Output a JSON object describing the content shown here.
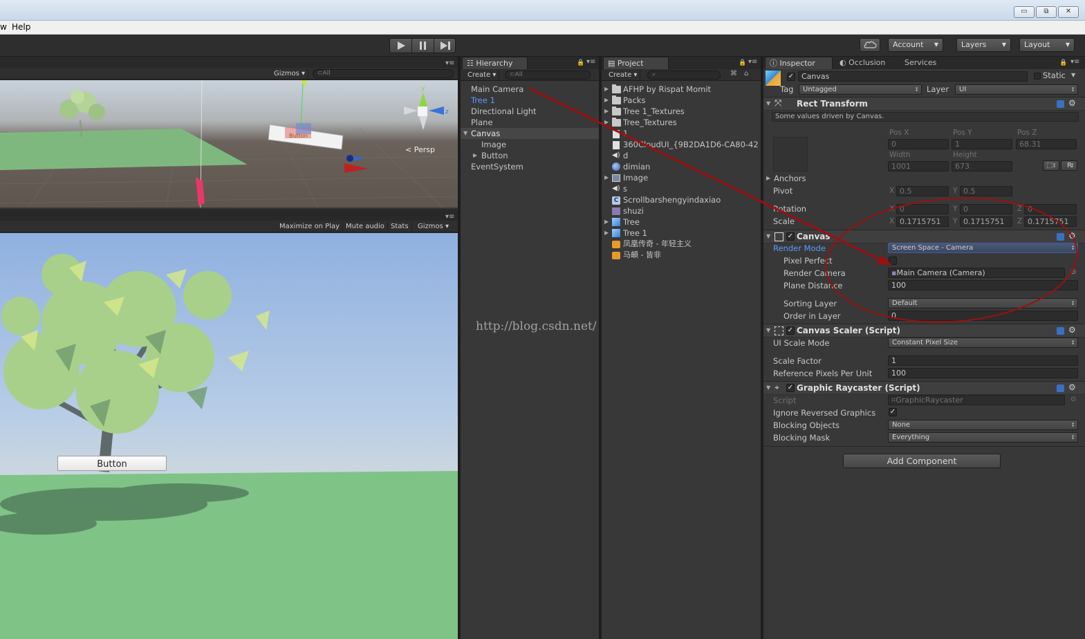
{
  "window": {
    "min": "▭",
    "max": "⧉",
    "close": "✕"
  },
  "menu": {
    "partial": "w",
    "help": "Help"
  },
  "toolbar": {
    "cloud_icon": "cloud-icon",
    "account": "Account",
    "layers": "Layers",
    "layout": "Layout"
  },
  "scene": {
    "gizmos": "Gizmos",
    "search_placeholder": "⊂All",
    "persp": "Persp",
    "axis_y": "y",
    "axis_z": "z",
    "object_label": "Button"
  },
  "game": {
    "maximize": "Maximize on Play",
    "mute": "Mute audio",
    "stats": "Stats",
    "gizmos": "Gizmos",
    "button_label": "Button"
  },
  "hierarchy": {
    "tab": "Hierarchy",
    "create": "Create",
    "search": "⊂All",
    "items": [
      "Main Camera",
      "Tree 1",
      "Directional Light",
      "Plane",
      "Canvas",
      "Image",
      "Button",
      "EventSystem"
    ]
  },
  "project": {
    "tab": "Project",
    "create": "Create",
    "items": [
      "AFHP by Rispat Momit",
      "Packs",
      "Tree 1_Textures",
      "Tree_Textures",
      "1",
      "360CloudUI_{9B2DA1D6-CA80-42",
      "d",
      "dimian",
      "Image",
      "s",
      "Scrollbarshengyindaxiao",
      "shuzi",
      "Tree",
      "Tree 1",
      "凤凰传奇 - 年轻主义",
      "马頔 - 皆非"
    ]
  },
  "watermark": "http://blog.csdn.net/",
  "inspector": {
    "tabs": [
      "Inspector",
      "Occlusion",
      "Services"
    ],
    "object_name": "Canvas",
    "static": "Static",
    "tag_label": "Tag",
    "tag_value": "Untagged",
    "layer_label": "Layer",
    "layer_value": "UI",
    "rect": {
      "title": "Rect Transform",
      "note": "Some values driven by Canvas.",
      "posx_label": "Pos X",
      "posy_label": "Pos Y",
      "posz_label": "Pos Z",
      "posx": "0",
      "posy": "1",
      "posz": "68.31",
      "width_label": "Width",
      "height_label": "Height",
      "width": "1001",
      "height": "673",
      "r_button": "R",
      "anchors": "Anchors",
      "pivot": "Pivot",
      "pivot_x": "0.5",
      "pivot_y": "0.5",
      "rotation": "Rotation",
      "rot_x": "0",
      "rot_y": "0",
      "rot_z": "0",
      "scale": "Scale",
      "scale_x": "0.1715751",
      "scale_y": "0.1715751",
      "scale_z": "0.1715751",
      "x": "X",
      "y": "Y",
      "z": "Z"
    },
    "canvas": {
      "title": "Canvas",
      "render_mode_label": "Render Mode",
      "render_mode": "Screen Space - Camera",
      "pixel_perfect": "Pixel Perfect",
      "render_camera_label": "Render Camera",
      "render_camera": "Main Camera (Camera)",
      "plane_distance_label": "Plane Distance",
      "plane_distance": "100",
      "sorting_layer_label": "Sorting Layer",
      "sorting_layer": "Default",
      "order_label": "Order in Layer",
      "order": "0"
    },
    "scaler": {
      "title": "Canvas Scaler (Script)",
      "mode_label": "UI Scale Mode",
      "mode": "Constant Pixel Size",
      "factor_label": "Scale Factor",
      "factor": "1",
      "ppu_label": "Reference Pixels Per Unit",
      "ppu": "100"
    },
    "raycaster": {
      "title": "Graphic Raycaster (Script)",
      "script_label": "Script",
      "script": "GraphicRaycaster",
      "ignore_label": "Ignore Reversed Graphics",
      "blocking_objects_label": "Blocking Objects",
      "blocking_objects": "None",
      "blocking_mask_label": "Blocking Mask",
      "blocking_mask": "Everything"
    },
    "add_component": "Add Component"
  },
  "colors": {
    "selected_blue": "#5b9bff",
    "annotation_red": "#9b1010"
  }
}
